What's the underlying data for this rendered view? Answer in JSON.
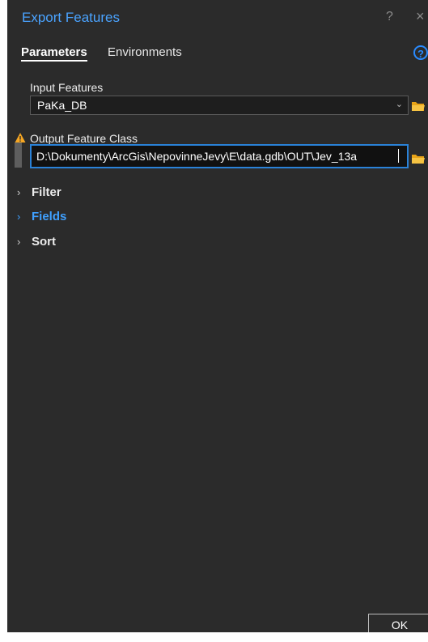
{
  "window": {
    "title": "Export Features",
    "help_label": "?",
    "close_label": "×"
  },
  "tabs": [
    {
      "label": "Parameters",
      "active": true
    },
    {
      "label": "Environments",
      "active": false
    }
  ],
  "help_circle": "?",
  "input_features": {
    "label": "Input Features",
    "value": "PaKa_DB"
  },
  "output_feature_class": {
    "label": "Output Feature Class",
    "value": "D:\\Dokumenty\\ArcGis\\NepovinneJevy\\E\\data.gdb\\OUT\\Jev_13a"
  },
  "sections": [
    {
      "label": "Filter",
      "expanded": false
    },
    {
      "label": "Fields",
      "expanded": false
    },
    {
      "label": "Sort",
      "expanded": false
    }
  ],
  "buttons": {
    "ok": "OK"
  },
  "colors": {
    "panel_bg": "#2b2b2b",
    "accent_blue": "#4aa3ff",
    "input_border": "#2a82d8",
    "warning_orange": "#f5a623"
  }
}
